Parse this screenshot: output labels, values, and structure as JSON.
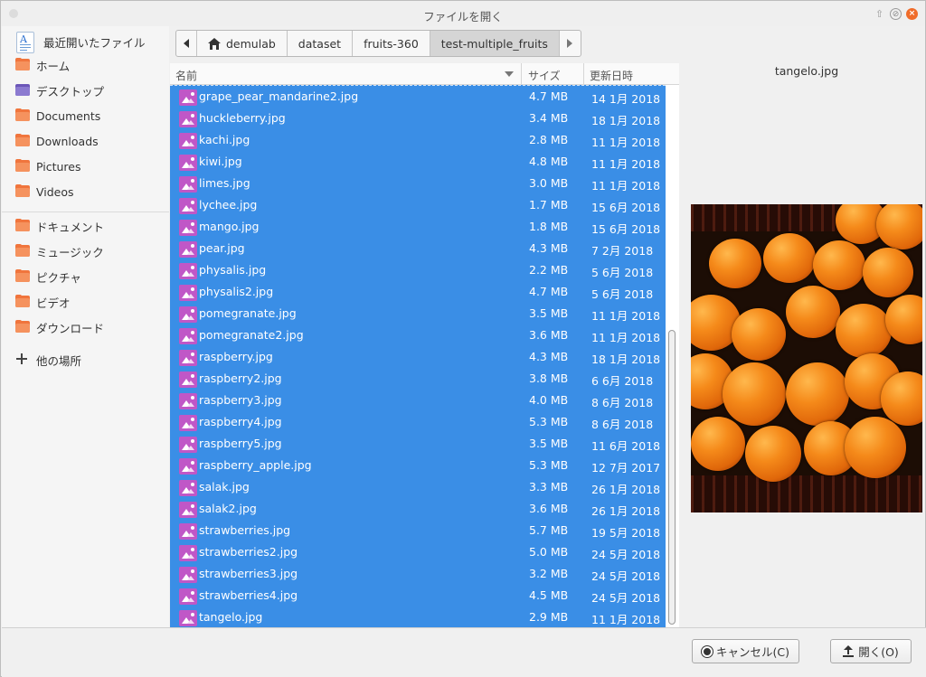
{
  "window": {
    "title": "ファイルを開く"
  },
  "sidebar": {
    "recent": "最近開いたファイル",
    "items": [
      {
        "label": "ホーム",
        "icon": "folder-icon"
      },
      {
        "label": "デスクトップ",
        "icon": "desktop-icon"
      },
      {
        "label": "Documents",
        "icon": "folder-icon"
      },
      {
        "label": "Downloads",
        "icon": "folder-icon"
      },
      {
        "label": "Pictures",
        "icon": "folder-icon"
      },
      {
        "label": "Videos",
        "icon": "folder-icon"
      },
      {
        "label": "ドキュメント",
        "icon": "folder-icon"
      },
      {
        "label": "ミュージック",
        "icon": "folder-icon"
      },
      {
        "label": "ピクチャ",
        "icon": "folder-icon"
      },
      {
        "label": "ビデオ",
        "icon": "folder-icon"
      },
      {
        "label": "ダウンロード",
        "icon": "folder-icon"
      }
    ],
    "other": "他の場所"
  },
  "pathbar": {
    "segments": [
      "demulab",
      "dataset",
      "fruits-360",
      "test-multiple_fruits"
    ]
  },
  "columns": {
    "name": "名前",
    "size": "サイズ",
    "modified": "更新日時"
  },
  "files": [
    {
      "name": "grape_pear_mandarine2.jpg",
      "size": "4.7 MB",
      "date": "14 1月 2018"
    },
    {
      "name": "huckleberry.jpg",
      "size": "3.4 MB",
      "date": "18 1月 2018"
    },
    {
      "name": "kachi.jpg",
      "size": "2.8 MB",
      "date": "11 1月 2018"
    },
    {
      "name": "kiwi.jpg",
      "size": "4.8 MB",
      "date": "11 1月 2018"
    },
    {
      "name": "limes.jpg",
      "size": "3.0 MB",
      "date": "11 1月 2018"
    },
    {
      "name": "lychee.jpg",
      "size": "1.7 MB",
      "date": "15 6月 2018"
    },
    {
      "name": "mango.jpg",
      "size": "1.8 MB",
      "date": "15 6月 2018"
    },
    {
      "name": "pear.jpg",
      "size": "4.3 MB",
      "date": "7 2月 2018"
    },
    {
      "name": "physalis.jpg",
      "size": "2.2 MB",
      "date": "5 6月 2018"
    },
    {
      "name": "physalis2.jpg",
      "size": "4.7 MB",
      "date": "5 6月 2018"
    },
    {
      "name": "pomegranate.jpg",
      "size": "3.5 MB",
      "date": "11 1月 2018"
    },
    {
      "name": "pomegranate2.jpg",
      "size": "3.6 MB",
      "date": "11 1月 2018"
    },
    {
      "name": "raspberry.jpg",
      "size": "4.3 MB",
      "date": "18 1月 2018"
    },
    {
      "name": "raspberry2.jpg",
      "size": "3.8 MB",
      "date": "6 6月 2018"
    },
    {
      "name": "raspberry3.jpg",
      "size": "4.0 MB",
      "date": "8 6月 2018"
    },
    {
      "name": "raspberry4.jpg",
      "size": "5.3 MB",
      "date": "8 6月 2018"
    },
    {
      "name": "raspberry5.jpg",
      "size": "3.5 MB",
      "date": "11 6月 2018"
    },
    {
      "name": "raspberry_apple.jpg",
      "size": "5.3 MB",
      "date": "12 7月 2017"
    },
    {
      "name": "salak.jpg",
      "size": "3.3 MB",
      "date": "26 1月 2018"
    },
    {
      "name": "salak2.jpg",
      "size": "3.6 MB",
      "date": "26 1月 2018"
    },
    {
      "name": "strawberries.jpg",
      "size": "5.7 MB",
      "date": "19 5月 2018"
    },
    {
      "name": "strawberries2.jpg",
      "size": "5.0 MB",
      "date": "24 5月 2018"
    },
    {
      "name": "strawberries3.jpg",
      "size": "3.2 MB",
      "date": "24 5月 2018"
    },
    {
      "name": "strawberries4.jpg",
      "size": "4.5 MB",
      "date": "24 5月 2018"
    },
    {
      "name": "tangelo.jpg",
      "size": "2.9 MB",
      "date": "11 1月 2018"
    }
  ],
  "preview": {
    "filename": "tangelo.jpg"
  },
  "buttons": {
    "cancel": "キャンセル(C)",
    "open": "開く(O)"
  },
  "colors": {
    "selection": "#3a8ee6",
    "folder": "#f0753d",
    "image_icon": "#c057c7",
    "close": "#f06c2a"
  }
}
